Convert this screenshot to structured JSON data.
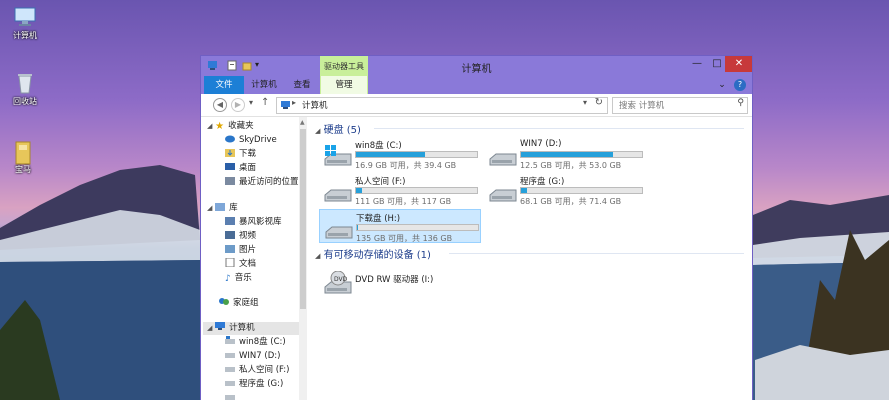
{
  "desktop": {
    "icons": [
      {
        "label": "计算机",
        "icon": "computer-icon"
      },
      {
        "label": "回收站",
        "icon": "recycle-bin-icon"
      },
      {
        "label": "宝马",
        "icon": "folder-icon"
      }
    ]
  },
  "window": {
    "title": "计算机",
    "context_tab_group": "驱动器工具",
    "tabs": [
      {
        "label": "文件"
      },
      {
        "label": "计算机"
      },
      {
        "label": "查看"
      },
      {
        "label": "管理"
      }
    ],
    "controls": {
      "minimize": "—",
      "maximize": "□",
      "close": "✕",
      "help": "?",
      "expand": "⌄"
    }
  },
  "address": {
    "path": "计算机",
    "search_placeholder": "搜索 计算机"
  },
  "nav": {
    "favorites": {
      "label": "收藏夹",
      "items": [
        "SkyDrive",
        "下载",
        "桌面",
        "最近访问的位置"
      ]
    },
    "libraries": {
      "label": "库",
      "items": [
        "暴风影视库",
        "视频",
        "图片",
        "文档",
        "音乐"
      ]
    },
    "homegroup": "家庭组",
    "computer": {
      "label": "计算机",
      "items": [
        "win8盘 (C:)",
        "WIN7 (D:)",
        "私人空间 (F:)",
        "程序盘 (G:)"
      ]
    }
  },
  "content": {
    "groups": [
      {
        "header": "硬盘 (5)",
        "drives": [
          {
            "name": "win8盘 (C:)",
            "free": "16.9 GB 可用，共 39.4 GB",
            "used_fraction": 0.57,
            "os": true,
            "selected": false
          },
          {
            "name": "WIN7 (D:)",
            "free": "12.5 GB 可用，共 53.0 GB",
            "used_fraction": 0.76,
            "os": false,
            "selected": false
          },
          {
            "name": "私人空间 (F:)",
            "free": "111 GB 可用，共 117 GB",
            "used_fraction": 0.05,
            "os": false,
            "selected": false
          },
          {
            "name": "程序盘 (G:)",
            "free": "68.1 GB 可用，共 71.4 GB",
            "used_fraction": 0.05,
            "os": false,
            "selected": false
          },
          {
            "name": "下载盘 (H:)",
            "free": "135 GB 可用，共 136 GB",
            "used_fraction": 0.01,
            "os": false,
            "selected": true
          }
        ]
      },
      {
        "header": "有可移动存储的设备 (1)",
        "devices": [
          {
            "name": "DVD RW 驱动器 (I:)",
            "icon": "dvd-drive-icon"
          }
        ]
      }
    ]
  },
  "colors": {
    "titlebar": "#8a79d9",
    "file_tab": "#1c7fd6",
    "context_tab": "#c9ef9a",
    "header_text": "#1e3e8c",
    "bar_fill": "#26a0da"
  }
}
